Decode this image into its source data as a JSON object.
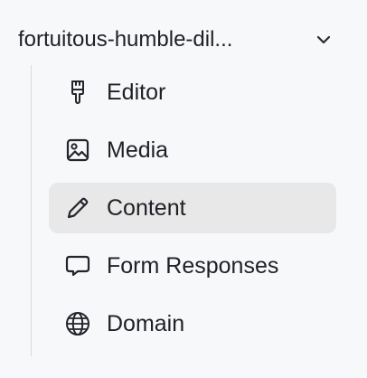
{
  "project": {
    "name": "fortuitous-humble-dil...",
    "expand_icon": "chevron-down-icon"
  },
  "nav": {
    "items": [
      {
        "label": "Editor",
        "icon": "paintbrush-icon",
        "active": false
      },
      {
        "label": "Media",
        "icon": "image-icon",
        "active": false
      },
      {
        "label": "Content",
        "icon": "pencil-icon",
        "active": true
      },
      {
        "label": "Form Responses",
        "icon": "message-square-icon",
        "active": false
      },
      {
        "label": "Domain",
        "icon": "globe-icon",
        "active": false
      }
    ]
  },
  "colors": {
    "background": "#f7f8fa",
    "active_item": "#e8e8e9",
    "text": "#1f2026",
    "rail": "#d9dbe1"
  }
}
